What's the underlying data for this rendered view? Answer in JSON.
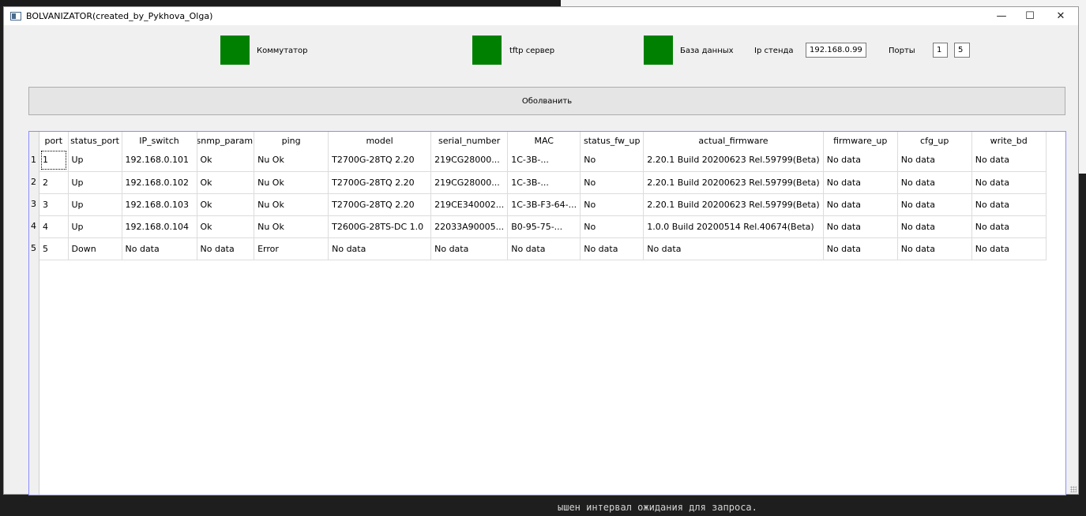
{
  "window": {
    "title": "BOLVANIZATOR(created_by_Pykhova_Olga)",
    "controls": {
      "minimize": "—",
      "maximize": "☐",
      "close": "✕"
    }
  },
  "indicators": [
    {
      "label": "Коммутатор",
      "color": "#008000"
    },
    {
      "label": "tftp сервер",
      "color": "#008000"
    },
    {
      "label": "База данных",
      "color": "#008000"
    }
  ],
  "stand": {
    "ip_label": "Ip стенда",
    "ip_value": "192.168.0.99",
    "ports_label": "Порты",
    "port_from": "1",
    "port_to": "5"
  },
  "action_button": "Оболванить",
  "table": {
    "columns": [
      "port",
      "status_port",
      "IP_switch",
      "snmp_param",
      "ping",
      "model",
      "serial_number",
      "MAC",
      "status_fw_up",
      "actual_firmware",
      "firmware_up",
      "cfg_up",
      "write_bd"
    ],
    "rows": [
      {
        "num": "1",
        "cells": [
          "1",
          "Up",
          "192.168.0.101",
          "Ok",
          "Nu Ok",
          "T2700G-28TQ 2.20",
          "219CG28000...",
          "1C-3B-...",
          "No",
          "2.20.1 Build 20200623 Rel.59799(Beta)",
          "No data",
          "No data",
          "No data"
        ]
      },
      {
        "num": "2",
        "cells": [
          "2",
          "Up",
          "192.168.0.102",
          "Ok",
          "Nu Ok",
          "T2700G-28TQ 2.20",
          "219CG28000...",
          "1C-3B-...",
          "No",
          "2.20.1 Build 20200623 Rel.59799(Beta)",
          "No data",
          "No data",
          "No data"
        ]
      },
      {
        "num": "3",
        "cells": [
          "3",
          "Up",
          "192.168.0.103",
          "Ok",
          "Nu Ok",
          "T2700G-28TQ 2.20",
          "219CE340002...",
          "1C-3B-F3-64-...",
          "No",
          "2.20.1 Build 20200623 Rel.59799(Beta)",
          "No data",
          "No data",
          "No data"
        ]
      },
      {
        "num": "4",
        "cells": [
          "4",
          "Up",
          "192.168.0.104",
          "Ok",
          "Nu Ok",
          "T2600G-28TS-DC 1.0",
          "22033A90005...",
          "B0-95-75-...",
          "No",
          "1.0.0 Build 20200514 Rel.40674(Beta)",
          "No data",
          "No data",
          "No data"
        ]
      },
      {
        "num": "5",
        "cells": [
          "5",
          "Down",
          "No data",
          "No data",
          "Error",
          "No data",
          "No data",
          "No data",
          "No data",
          "No data",
          "No data",
          "No data",
          "No data"
        ]
      }
    ]
  },
  "background_console_text": "ышен интервал ожидания для запроса."
}
